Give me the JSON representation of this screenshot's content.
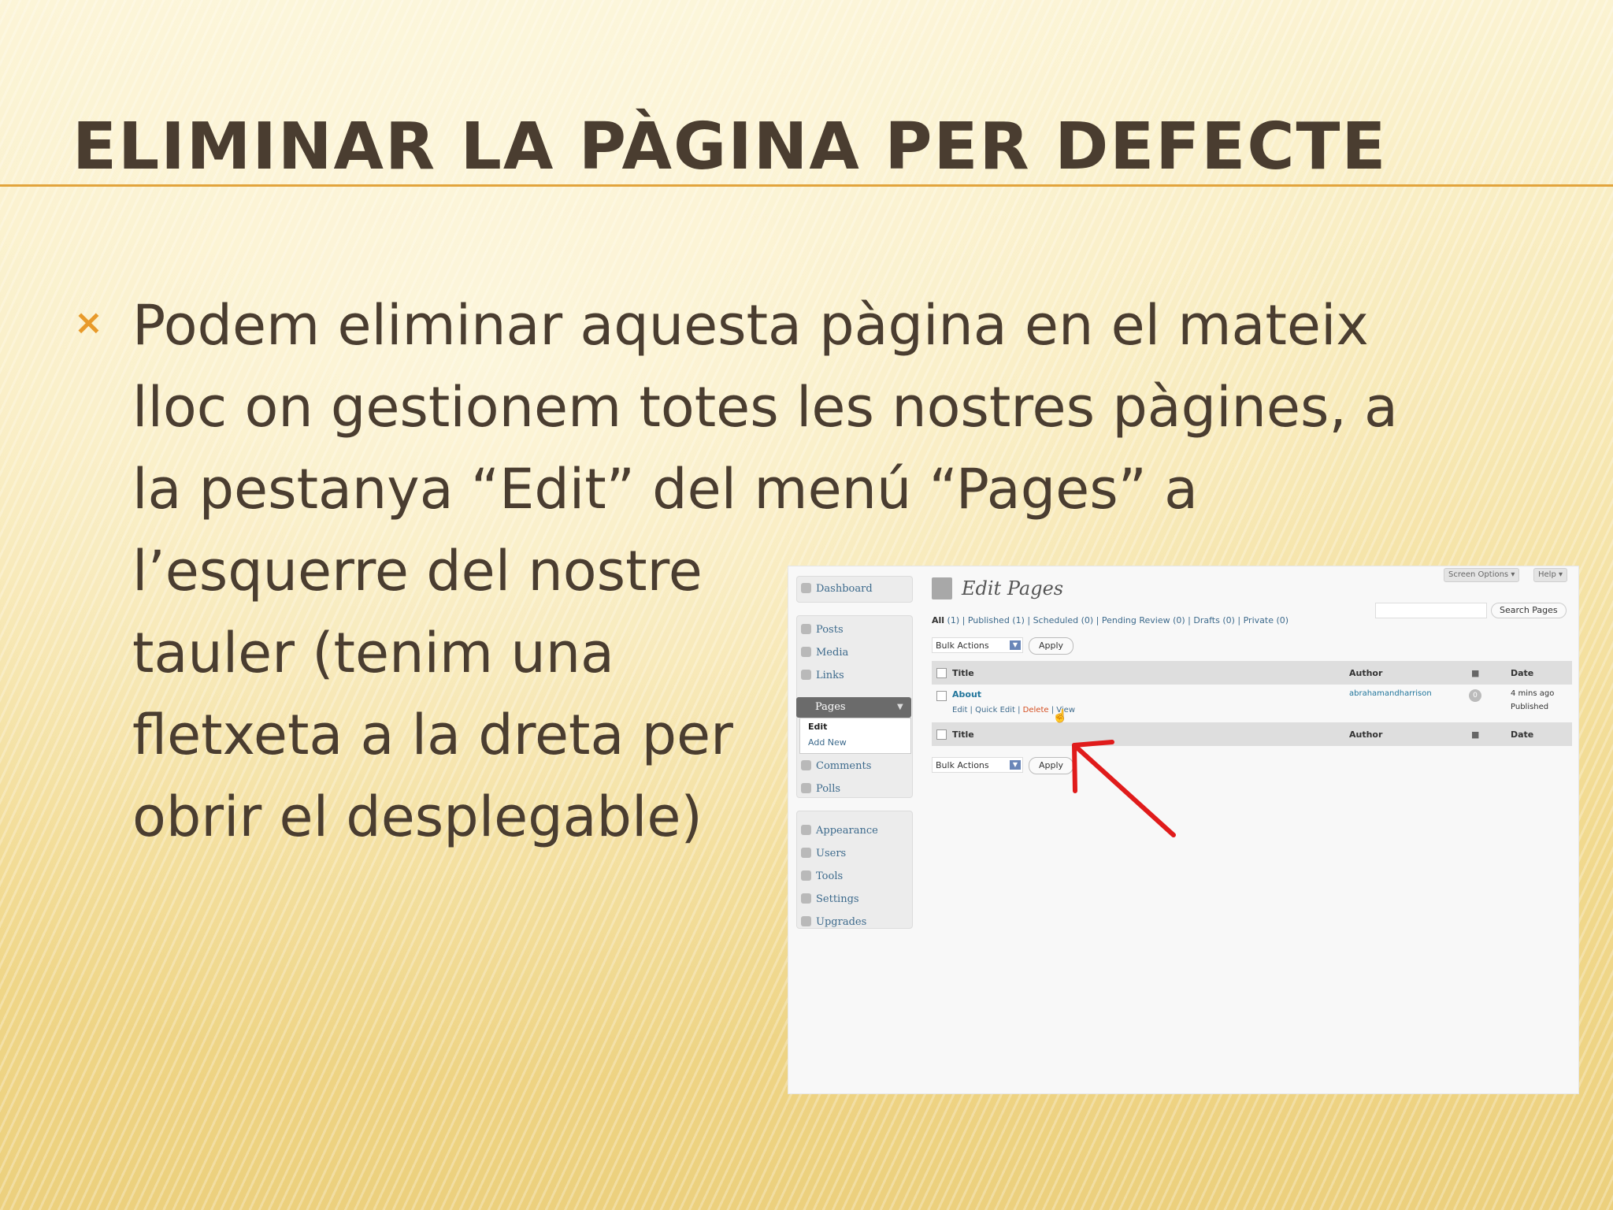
{
  "slide": {
    "title": "ELIMINAR LA PÀGINA PER DEFECTE",
    "bullet_icon": "×",
    "lines": [
      "Podem eliminar aquesta pàgina en el mateix",
      "lloc on gestionem totes les nostres pàgines, a",
      "la pestanya “Edit” del menú “Pages” a",
      "l’esquerre del nostre",
      "tauler (tenim una",
      "fletxeta a la dreta per",
      "obrir el desplegable)"
    ],
    "colors": {
      "text": "#4a3d30",
      "accent": "#e89a2a",
      "rule": "#e2a43c"
    }
  },
  "screenshot": {
    "top_buttons": [
      "Screen Options ▾",
      "Help ▾"
    ],
    "sidebar": {
      "dashboard": "Dashboard",
      "posts": "Posts",
      "media": "Media",
      "links": "Links",
      "pages": "Pages",
      "submenu": [
        "Edit",
        "Add New"
      ],
      "comments": "Comments",
      "polls": "Polls",
      "appearance": "Appearance",
      "users": "Users",
      "tools": "Tools",
      "settings": "Settings",
      "upgrades": "Upgrades"
    },
    "heading": "Edit Pages",
    "filters": {
      "all": "All",
      "rest": " (1) | Published (1) | Scheduled (0) | Pending Review (0) | Drafts (0) | Private (0)"
    },
    "search_button": "Search Pages",
    "bulk_actions": "Bulk Actions",
    "apply": "Apply",
    "columns": [
      "Title",
      "Author",
      "Date"
    ],
    "row": {
      "title": "About",
      "actions": [
        "Edit",
        "Quick Edit",
        "Delete",
        "View"
      ],
      "author": "abrahamandharrison",
      "comments": "0",
      "date_line1": "4 mins ago",
      "date_line2": "Published"
    }
  }
}
